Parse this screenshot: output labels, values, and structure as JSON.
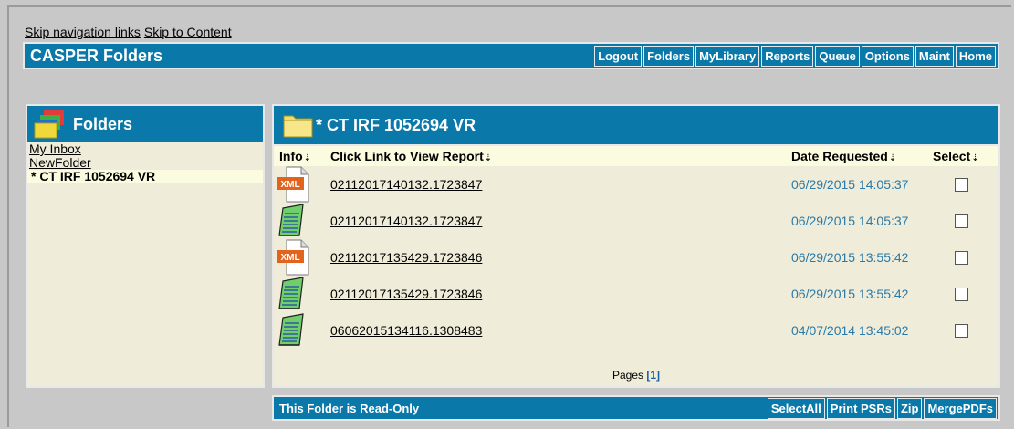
{
  "skip": {
    "nav": "Skip navigation links",
    "content": "Skip to Content"
  },
  "app_title": "CASPER Folders",
  "nav_buttons": [
    "Logout",
    "Folders",
    "MyLibrary",
    "Reports",
    "Queue",
    "Options",
    "Maint",
    "Home"
  ],
  "left_panel": {
    "title": "Folders",
    "items": [
      "My Inbox",
      "NewFolder",
      "* CT IRF 1052694 VR"
    ]
  },
  "main_panel": {
    "title": "* CT IRF 1052694 VR",
    "columns": {
      "info": "Info",
      "link": "Click Link to View Report",
      "date": "Date Requested",
      "select": "Select"
    },
    "rows": [
      {
        "icon": "xml-file-icon",
        "icon_label": "XML",
        "link": "02112017140132.1723847",
        "date": "06/29/2015 14:05:37"
      },
      {
        "icon": "notepad-icon",
        "link": "02112017140132.1723847",
        "date": "06/29/2015 14:05:37"
      },
      {
        "icon": "xml-file-icon",
        "icon_label": "XML",
        "link": "02112017135429.1723846",
        "date": "06/29/2015 13:55:42"
      },
      {
        "icon": "notepad-icon",
        "link": "02112017135429.1723846",
        "date": "06/29/2015 13:55:42"
      },
      {
        "icon": "notepad-icon",
        "link": "06062015134116.1308483",
        "date": "04/07/2014 13:45:02"
      }
    ],
    "pages_label": "Pages",
    "page_link": "[1]"
  },
  "bottom": {
    "status": "This Folder is Read-Only",
    "buttons": [
      "SelectAll",
      "Print PSRs",
      "Zip",
      "MergePDFs"
    ]
  },
  "colors": {
    "bar": "#0a78a8",
    "panel": "#efecd9",
    "date": "#2a7aa8"
  }
}
